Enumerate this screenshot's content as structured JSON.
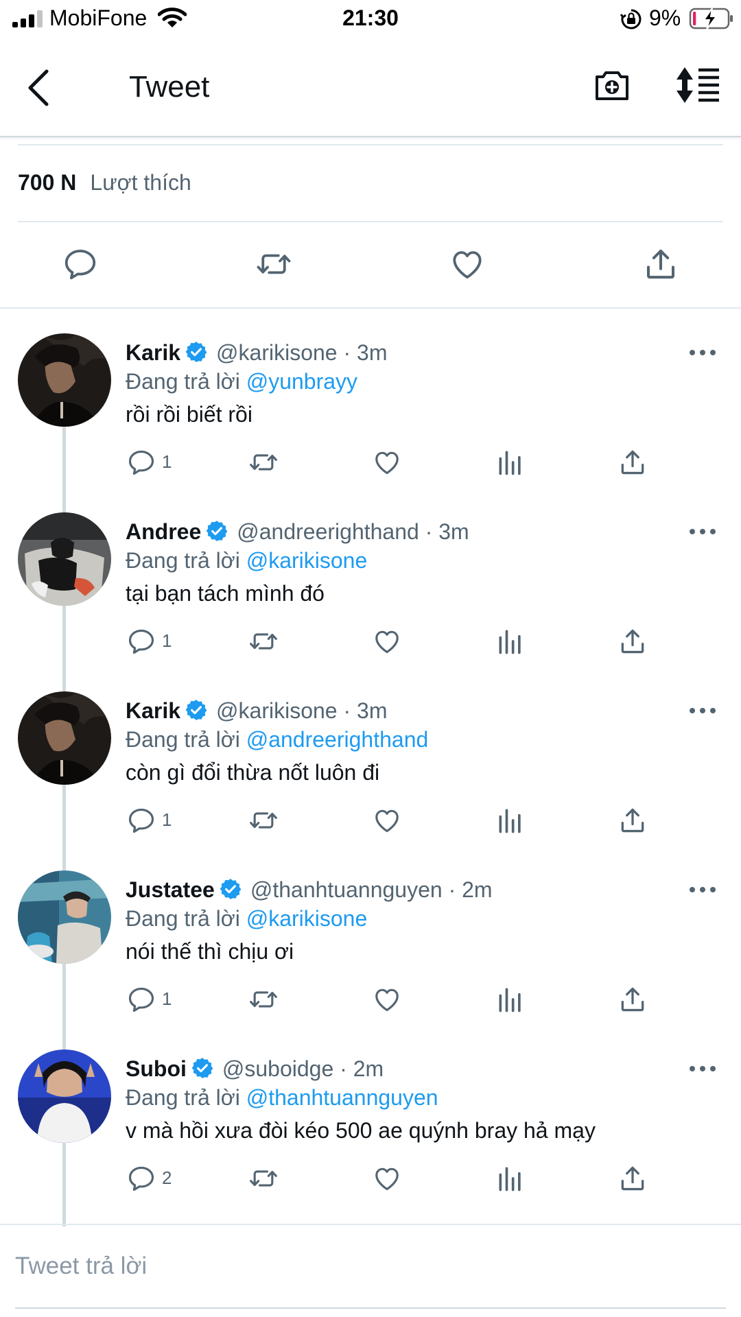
{
  "status_bar": {
    "carrier": "MobiFone",
    "time": "21:30",
    "battery_percent": "9%",
    "battery_level": 0.09
  },
  "nav": {
    "title": "Tweet"
  },
  "likes": {
    "count": "700 N",
    "label": "Lượt thích"
  },
  "colors": {
    "accent_blue": "#1d9bf0",
    "secondary_text": "#536471",
    "icon_gray": "#536471",
    "battery_low": "#e0245e"
  },
  "replies": [
    {
      "name": "Karik",
      "verified": true,
      "handle": "@karikisone",
      "time": "· 3m",
      "replying_prefix": "Đang trả lời",
      "replying_to": "@yunbrayy",
      "text": "rồi rồi biết rồi",
      "reply_count": "1"
    },
    {
      "name": "Andree",
      "verified": true,
      "handle": "@andreerighthand",
      "time": "· 3m",
      "replying_prefix": "Đang trả lời",
      "replying_to": "@karikisone",
      "text": "tại bạn tách mình đó",
      "reply_count": "1"
    },
    {
      "name": "Karik",
      "verified": true,
      "handle": "@karikisone",
      "time": "· 3m",
      "replying_prefix": "Đang trả lời",
      "replying_to": "@andreerighthand",
      "text": "còn gì đổi thừa nốt luôn đi",
      "reply_count": "1"
    },
    {
      "name": "Justatee",
      "verified": true,
      "handle": "@thanhtuannguyen",
      "time": "· 2m",
      "replying_prefix": "Đang trả lời",
      "replying_to": "@karikisone",
      "text": "nói thế thì chịu ơi",
      "reply_count": "1"
    },
    {
      "name": "Suboi",
      "verified": true,
      "handle": "@suboidge",
      "time": "· 2m",
      "replying_prefix": "Đang trả lời",
      "replying_to": "@thanhtuannguyen",
      "text": "v mà hồi xưa đòi kéo 500 ae quýnh bray hả mạy",
      "reply_count": "2"
    }
  ],
  "compose": {
    "placeholder": "Tweet trả lời"
  }
}
